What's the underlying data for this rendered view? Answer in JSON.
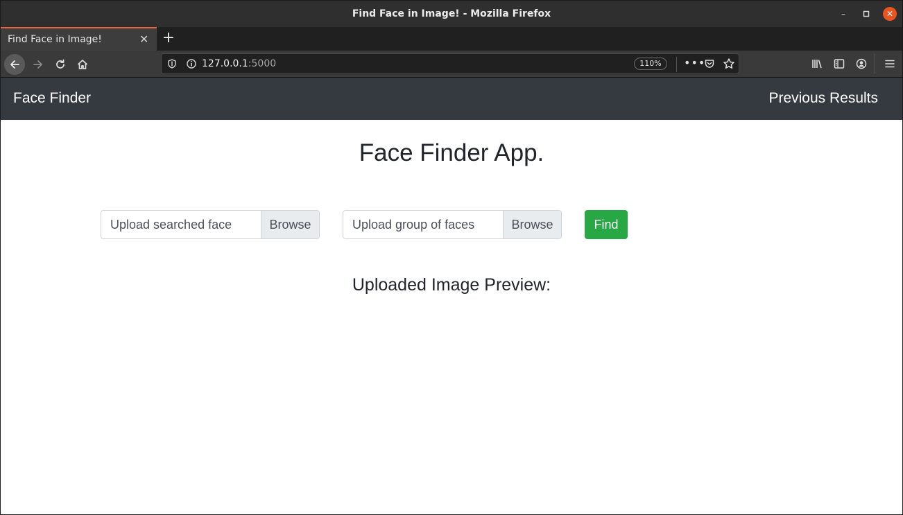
{
  "window": {
    "title": "Find Face in Image! - Mozilla Firefox",
    "controls": {
      "minimize": "–",
      "maximize": "▫",
      "close": "✕"
    }
  },
  "tabs": [
    {
      "label": "Find Face in Image!",
      "active": true
    }
  ],
  "new_tab": "+",
  "urlbar": {
    "host": "127.0.0.1",
    "port": ":5000",
    "zoom": "110%",
    "more": "•••"
  },
  "page": {
    "navbar": {
      "brand": "Face Finder",
      "link": "Previous Results",
      "background": "#343a40"
    },
    "heading": "Face Finder App.",
    "upload_searched": {
      "placeholder": "Upload searched face",
      "browse": "Browse"
    },
    "upload_group": {
      "placeholder": "Upload group of faces",
      "browse": "Browse"
    },
    "find_button": {
      "label": "Find",
      "color": "#28a745"
    },
    "preview_heading": "Uploaded Image Preview:"
  },
  "icons": {
    "back": "arrow-left-icon",
    "forward": "arrow-right-icon",
    "reload": "reload-icon",
    "home": "home-icon",
    "shield": "shield-icon",
    "info": "info-icon",
    "pocket": "pocket-icon",
    "star": "star-icon",
    "library": "library-icon",
    "sidebar": "sidebar-icon",
    "account": "account-icon",
    "menu": "hamburger-menu-icon"
  }
}
